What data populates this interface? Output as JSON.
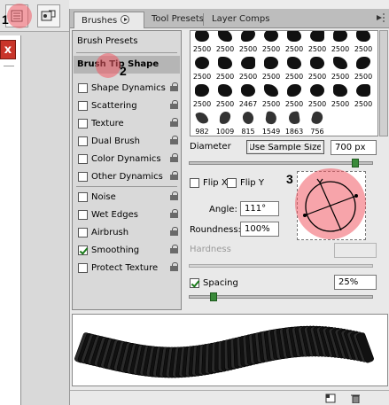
{
  "markers": [
    "1",
    "2",
    "3"
  ],
  "left_dock": {
    "close_label": "x"
  },
  "tabs": [
    {
      "label": "Brushes",
      "active": true
    },
    {
      "label": "Tool Presets",
      "active": false
    },
    {
      "label": "Layer Comps",
      "active": false
    }
  ],
  "sidebar": {
    "presets_label": "Brush Presets",
    "selected_label": "Brush Tip Shape",
    "options": [
      {
        "label": "Shape Dynamics",
        "checked": false
      },
      {
        "label": "Scattering",
        "checked": false
      },
      {
        "label": "Texture",
        "checked": false
      },
      {
        "label": "Dual Brush",
        "checked": false
      },
      {
        "label": "Color Dynamics",
        "checked": false
      },
      {
        "label": "Other Dynamics",
        "checked": false
      },
      {
        "label": "Noise",
        "checked": false
      },
      {
        "label": "Wet Edges",
        "checked": false
      },
      {
        "label": "Airbrush",
        "checked": false
      },
      {
        "label": "Smoothing",
        "checked": true
      },
      {
        "label": "Protect Texture",
        "checked": false
      }
    ]
  },
  "brush_grid": [
    [
      "2500",
      "2500",
      "2500",
      "2500",
      "2500",
      "2500",
      "2500",
      "2500"
    ],
    [
      "2500",
      "2500",
      "2500",
      "2500",
      "2500",
      "2500",
      "2500",
      "2500"
    ],
    [
      "2500",
      "2500",
      "2467",
      "2500",
      "2500",
      "2500",
      "2500",
      "2500"
    ],
    [
      "982",
      "1009",
      "815",
      "1549",
      "1863",
      "756",
      "",
      ""
    ]
  ],
  "diameter": {
    "label": "Diameter",
    "button_label": "Use Sample Size",
    "value": "700 px",
    "slider_fraction": 0.92
  },
  "flip_x": {
    "label": "Flip X",
    "checked": false
  },
  "flip_y": {
    "label": "Flip Y",
    "checked": false
  },
  "angle": {
    "label": "Angle:",
    "value": "111°"
  },
  "roundness": {
    "label": "Roundness:",
    "value": "100%"
  },
  "hardness": {
    "label": "Hardness",
    "value": ""
  },
  "spacing": {
    "label": "Spacing",
    "checked": true,
    "value": "25%",
    "slider_fraction": 0.12
  },
  "colors": {
    "marker": "#f05a64",
    "slider_thumb": "#3a8a3a"
  },
  "icons": [
    "palette-well-icon",
    "tool-preset-icon",
    "panel-menu-icon",
    "lock-icon",
    "new-brush-icon",
    "trash-icon"
  ]
}
